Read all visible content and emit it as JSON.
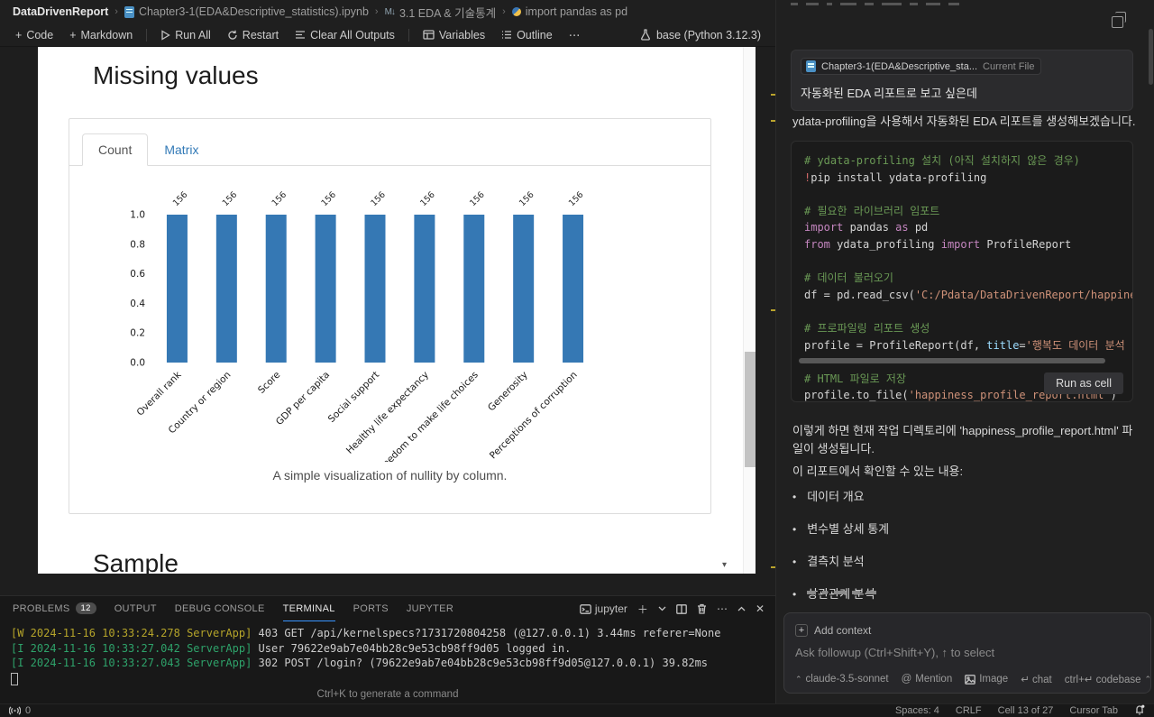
{
  "breadcrumb": {
    "root": "DataDrivenReport",
    "file": "Chapter3-1(EDA&Descriptive_statistics).ipynb",
    "section": "3.1 EDA & 기술통계",
    "section_icon": "M↓",
    "cell": "import pandas as pd"
  },
  "toolbar": {
    "code": "Code",
    "markdown": "Markdown",
    "run_all": "Run All",
    "restart": "Restart",
    "clear_outputs": "Clear All Outputs",
    "variables": "Variables",
    "outline": "Outline",
    "more": "⋯",
    "kernel": "base (Python 3.12.3)",
    "plus": "+"
  },
  "notebook": {
    "heading_missing": "Missing values",
    "heading_sample": "Sample",
    "tabs": [
      {
        "label": "Count",
        "active": true
      },
      {
        "label": "Matrix",
        "active": false
      }
    ],
    "caption": "A simple visualization of nullity by column.",
    "more_arrow": "▾"
  },
  "chart_data": {
    "type": "bar",
    "title": "",
    "xlabel": "",
    "ylabel": "",
    "categories": [
      "Overall rank",
      "Country or region",
      "Score",
      "GDP per capita",
      "Social support",
      "Healthy life expectancy",
      "Freedom to make life choices",
      "Generosity",
      "Perceptions of corruption"
    ],
    "values": [
      1.0,
      1.0,
      1.0,
      1.0,
      1.0,
      1.0,
      1.0,
      1.0,
      1.0
    ],
    "bar_labels": [
      156,
      156,
      156,
      156,
      156,
      156,
      156,
      156,
      156
    ],
    "ylim": [
      0.0,
      1.0
    ],
    "yticks": [
      0.0,
      0.2,
      0.4,
      0.6,
      0.8,
      1.0
    ],
    "bar_color": "#3578b4",
    "grid": false,
    "legend": false
  },
  "chat": {
    "file_chip": {
      "name": "Chapter3-1(EDA&Descriptive_sta...",
      "badge": "Current File"
    },
    "user_message": "자동화된 EDA 리포트로 보고 싶은데",
    "intro": "ydata-profiling을 사용해서 자동화된 EDA 리포트를 생성해보겠습니다.",
    "code": {
      "lines": [
        [
          {
            "t": "# ydata-profiling 설치 (아직 설치하지 않은 경우)",
            "c": "com"
          }
        ],
        [
          {
            "t": "!",
            "c": "bang"
          },
          {
            "t": "pip install ydata-profiling",
            "c": "pl"
          }
        ],
        [],
        [
          {
            "t": "# 필요한 라이브러리 임포트",
            "c": "com"
          }
        ],
        [
          {
            "t": "import",
            "c": "kw"
          },
          {
            "t": " pandas ",
            "c": "pl"
          },
          {
            "t": "as",
            "c": "kw"
          },
          {
            "t": " pd",
            "c": "pl"
          }
        ],
        [
          {
            "t": "from",
            "c": "kw"
          },
          {
            "t": " ydata_profiling ",
            "c": "pl"
          },
          {
            "t": "import",
            "c": "kw"
          },
          {
            "t": " ProfileReport",
            "c": "pl"
          }
        ],
        [],
        [
          {
            "t": "# 데이터 불러오기",
            "c": "com"
          }
        ],
        [
          {
            "t": "df = pd.read_csv(",
            "c": "pl"
          },
          {
            "t": "'C:/Pdata/DataDrivenReport/happiness.csv",
            "c": "str"
          }
        ],
        [],
        [
          {
            "t": "# 프로파일링 리포트 생성",
            "c": "com"
          }
        ],
        [
          {
            "t": "profile = ProfileReport(df, ",
            "c": "pl"
          },
          {
            "t": "title",
            "c": "par"
          },
          {
            "t": "=",
            "c": "pl"
          },
          {
            "t": "'행복도 데이터 분석 리포트",
            "c": "str"
          }
        ],
        [],
        [
          {
            "t": "# HTML 파일로 저장",
            "c": "com"
          }
        ],
        [
          {
            "t": "profile.to_file(",
            "c": "pl"
          },
          {
            "t": "'happiness_profile_report.html'",
            "c": "str"
          },
          {
            "t": ")",
            "c": "pl"
          }
        ]
      ]
    },
    "run_as_cell": "Run as cell",
    "after_1": "이렇게 하면 현재 작업 디렉토리에 'happiness_profile_report.html' 파일이 생성됩니다.",
    "after_2": "이 리포트에서 확인할 수 있는 내용:",
    "bullets": [
      "데이터 개요",
      "변수별 상세 통계",
      "결측치 분석",
      "상관관계 분석"
    ],
    "input": {
      "add_context": "Add context",
      "placeholder": "Ask followup (Ctrl+Shift+Y), ↑ to select",
      "model": "claude-3.5-sonnet",
      "mention": "Mention",
      "image": "Image",
      "send_chat": "↵ chat",
      "send_codebase": "ctrl+↵ codebase"
    }
  },
  "bottom_panel": {
    "tabs": [
      {
        "label": "PROBLEMS",
        "badge": "12"
      },
      {
        "label": "OUTPUT"
      },
      {
        "label": "DEBUG CONSOLE"
      },
      {
        "label": "TERMINAL",
        "active": true
      },
      {
        "label": "PORTS"
      },
      {
        "label": "JUPYTER"
      }
    ],
    "terminal_name": "jupyter",
    "lines": [
      {
        "level": "warn",
        "prefix": "[W 2024-11-16 10:33:24.278 ServerApp]",
        "text": " 403 GET /api/kernelspecs?1731720804258 (@127.0.0.1) 3.44ms referer=None"
      },
      {
        "level": "info",
        "prefix": "[I 2024-11-16 10:33:27.042 ServerApp]",
        "text": " User 79622e9ab7e04bb28c9e53cb98ff9d05 logged in."
      },
      {
        "level": "info",
        "prefix": "[I 2024-11-16 10:33:27.043 ServerApp]",
        "text": " 302 POST /login? (79622e9ab7e04bb28c9e53cb98ff9d05@127.0.0.1) 39.82ms"
      }
    ],
    "hint": "Ctrl+K to generate a command"
  },
  "status_bar": {
    "remote_count": "0",
    "items": [
      "Spaces: 4",
      "CRLF",
      "Cell 13 of 27",
      "Cursor Tab"
    ]
  }
}
